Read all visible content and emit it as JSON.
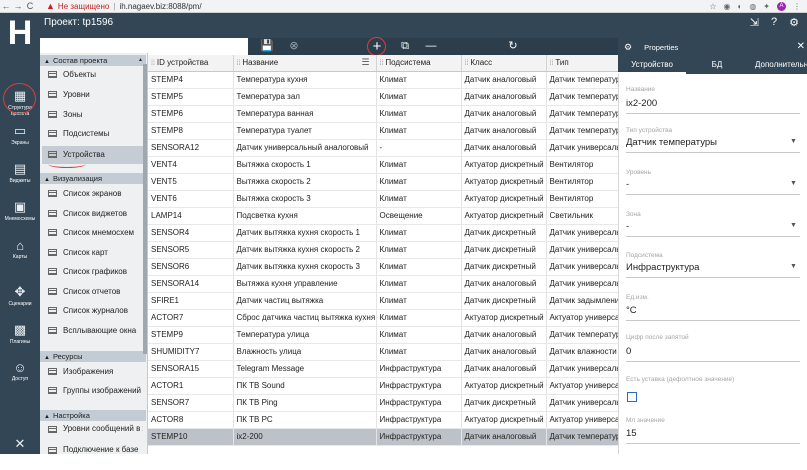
{
  "browser": {
    "nav_back": "←",
    "nav_forward": "→",
    "nav_reload": "C",
    "warning_icon": "▲",
    "not_secure": "Не защищено",
    "separator": "|",
    "url": "ih.nagaev.biz:8088/pm/"
  },
  "header": {
    "logo": "H",
    "project_title": "Проект: tp1596"
  },
  "toolbar": {
    "save": "💾",
    "cancel": "⊗",
    "add": "+",
    "copy": "⧉",
    "remove": "—",
    "refresh": "↻"
  },
  "topicons": {
    "export": "⇲",
    "help": "?",
    "settings": "⚙"
  },
  "leftnav": [
    {
      "label": "Структура проекта",
      "icon": "▦"
    },
    {
      "label": "Экраны",
      "icon": "▭"
    },
    {
      "label": "Виджеты",
      "icon": "▤"
    },
    {
      "label": "Мнемосхемы",
      "icon": "▣"
    },
    {
      "label": "Карты",
      "icon": "⌂"
    },
    {
      "label": "Сценарии",
      "icon": "✥"
    },
    {
      "label": "Плагины",
      "icon": "▩"
    },
    {
      "label": "Доступ",
      "icon": "☺"
    },
    {
      "label": "",
      "icon": "✕"
    }
  ],
  "tree": {
    "sections": [
      {
        "label": "Состав проекта"
      },
      {
        "label": "Визуализация"
      },
      {
        "label": "Ресурсы"
      },
      {
        "label": "Настройка"
      }
    ],
    "items": [
      "Объекты",
      "Уровни",
      "Зоны",
      "Подсистемы",
      "Устройства",
      "Список экранов",
      "Список виджетов",
      "Список мнемосхем",
      "Список карт",
      "Список графиков",
      "Список отчетов",
      "Список журналов",
      "Всплывающие окна",
      "Изображения",
      "Группы изображений",
      "Уровни сообщений в журналах",
      "Подключение к базе"
    ]
  },
  "grid": {
    "columns": [
      "ID устройства",
      "Название",
      "Подсистема",
      "Класс",
      "Тип"
    ],
    "rows": [
      [
        "STEMP4",
        "Температура кухня",
        "Климат",
        "Датчик аналоговый",
        "Датчик температуры"
      ],
      [
        "STEMP5",
        "Температура зал",
        "Климат",
        "Датчик аналоговый",
        "Датчик температуры"
      ],
      [
        "STEMP6",
        "Температура ванная",
        "Климат",
        "Датчик аналоговый",
        "Датчик температуры"
      ],
      [
        "STEMP8",
        "Температура туалет",
        "Климат",
        "Датчик аналоговый",
        "Датчик температуры"
      ],
      [
        "SENSORA12",
        "Датчик универсальный аналоговый",
        "-",
        "Датчик аналоговый",
        "Датчик универсальный"
      ],
      [
        "VENT4",
        "Вытяжка скорость 1",
        "Климат",
        "Актуатор дискретный",
        "Вентилятор"
      ],
      [
        "VENT5",
        "Вытяжка скорость 2",
        "Климат",
        "Актуатор дискретный",
        "Вентилятор"
      ],
      [
        "VENT6",
        "Вытяжка скорость 3",
        "Климат",
        "Актуатор дискретный",
        "Вентилятор"
      ],
      [
        "LAMP14",
        "Подсветка кухня",
        "Освещение",
        "Актуатор дискретный",
        "Светильник"
      ],
      [
        "SENSOR4",
        "Датчик вытяжка кухня скорость 1",
        "Климат",
        "Датчик дискретный",
        "Датчик универсальный"
      ],
      [
        "SENSOR5",
        "Датчик вытяжка кухня скорость 2",
        "Климат",
        "Датчик дискретный",
        "Датчик универсальный"
      ],
      [
        "SENSOR6",
        "Датчик вытяжка кухня скорость 3",
        "Климат",
        "Датчик дискретный",
        "Датчик универсальный"
      ],
      [
        "SENSORA14",
        "Вытяжка кухня управление",
        "Климат",
        "Датчик аналоговый",
        "Датчик универсальный"
      ],
      [
        "SFIRE1",
        "Датчик частиц вытяжка",
        "Климат",
        "Датчик дискретный",
        "Датчик задымления"
      ],
      [
        "ACTOR7",
        "Сброс датчика частиц вытяжка кухня",
        "Климат",
        "Актуатор дискретный",
        "Актуатор универсальный"
      ],
      [
        "STEMP9",
        "Температура улица",
        "Климат",
        "Датчик аналоговый",
        "Датчик температуры"
      ],
      [
        "SHUMIDITY7",
        "Влажность улица",
        "Климат",
        "Датчик аналоговый",
        "Датчик влажности"
      ],
      [
        "SENSORA15",
        "Telegram Message",
        "Инфраструктура",
        "Датчик аналоговый",
        "Датчик универсальный"
      ],
      [
        "ACTOR1",
        "ПК ТВ Sound",
        "Инфраструктура",
        "Актуатор дискретный",
        "Актуатор универсальный"
      ],
      [
        "SENSOR7",
        "ПК ТВ Ping",
        "Инфраструктура",
        "Датчик дискретный",
        "Датчик универсальный"
      ],
      [
        "ACTOR8",
        "ПК ТВ PC",
        "Инфраструктура",
        "Актуатор дискретный",
        "Актуатор универсальный"
      ],
      [
        "STEMP10",
        "ix2-200",
        "Инфраструктура",
        "Датчик аналоговый",
        "Датчик температуры"
      ]
    ]
  },
  "panel": {
    "title": "Properties",
    "tabs": [
      "Устройство",
      "БД",
      "Дополнительно"
    ],
    "fields": [
      {
        "label": "Название",
        "value": "ix2-200"
      },
      {
        "label": "Тип устройства",
        "value": "Датчик температуры"
      },
      {
        "label": "Уровень",
        "value": "-"
      },
      {
        "label": "Зона",
        "value": "-"
      },
      {
        "label": "Подсистема",
        "value": "Инфраструктура"
      },
      {
        "label": "Ед.изм.",
        "value": "°C"
      },
      {
        "label": "Цифр после запятой",
        "value": "0"
      },
      {
        "label": "Есть уставка (дефолтное значение)",
        "value": ""
      },
      {
        "label": "Мл значение",
        "value": "15"
      }
    ]
  }
}
